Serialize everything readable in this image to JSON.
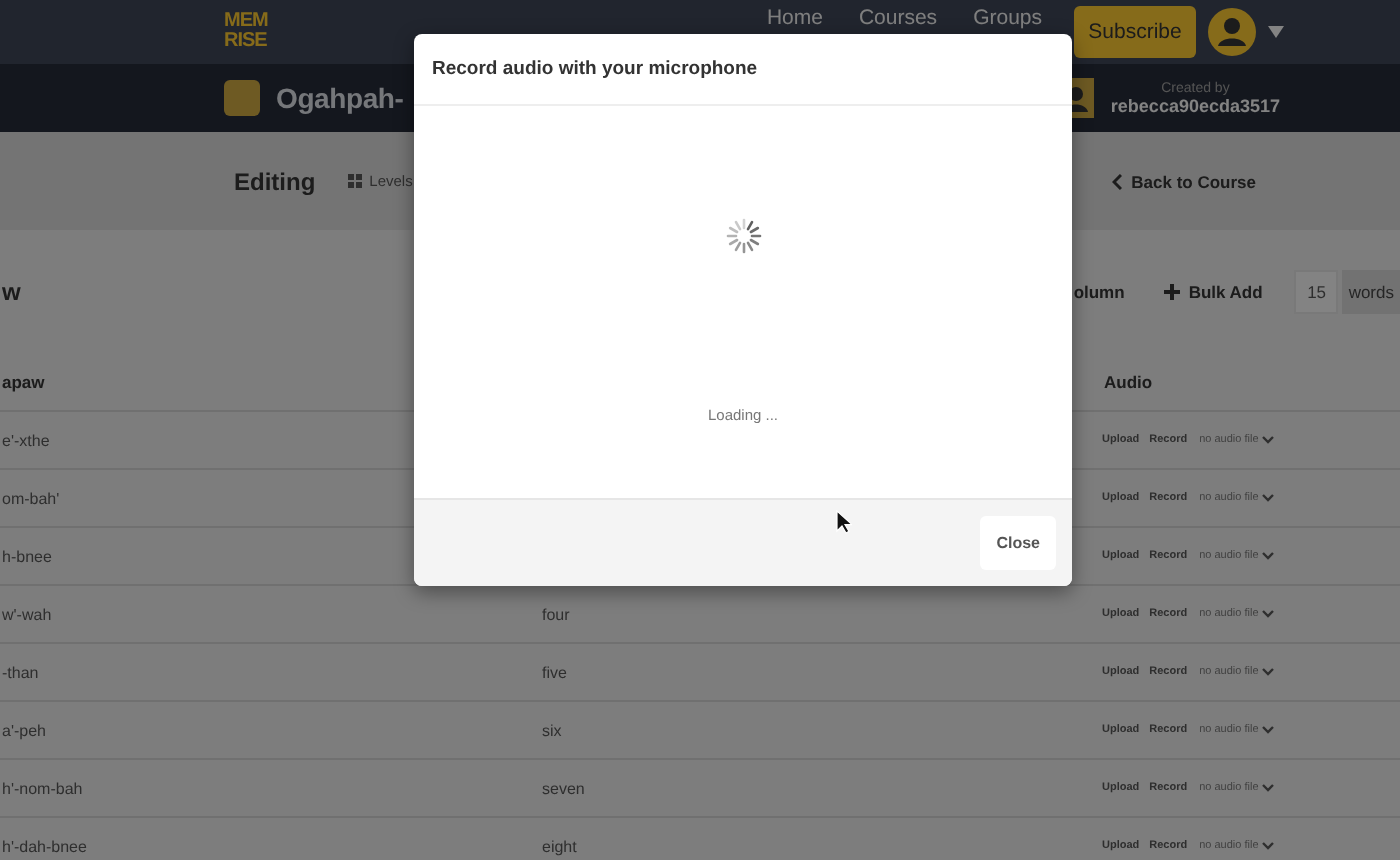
{
  "nav": {
    "logo": [
      "MEM",
      "RISE"
    ],
    "links": [
      "Home",
      "Courses",
      "Groups"
    ],
    "subscribe": "Subscribe"
  },
  "course_bar": {
    "title": "Ogahpah-",
    "created_label": "Created by",
    "creator": "rebecca90ecda3517"
  },
  "sub_nav": {
    "title": "Editing",
    "levels": "Levels",
    "back": "Back to Course"
  },
  "level": {
    "title": "w",
    "column_button": "olumn",
    "bulk_add": "Bulk Add",
    "count": "15",
    "count_unit": "words"
  },
  "table": {
    "columns": [
      "apaw",
      "Audio"
    ],
    "rows": [
      {
        "column_1": "e'-xthe",
        "audio": {
          "upload": "Upload",
          "record": "Record",
          "status": "no audio file"
        }
      },
      {
        "column_1": "om-bah'",
        "audio": {
          "upload": "Upload",
          "record": "Record",
          "status": "no audio file"
        }
      },
      {
        "column_1": "h-bnee",
        "audio": {
          "upload": "Upload",
          "record": "Record",
          "status": "no audio file"
        }
      },
      {
        "column_1": "w'-wah",
        "column_2": "four",
        "audio": {
          "upload": "Upload",
          "record": "Record",
          "status": "no audio file"
        }
      },
      {
        "column_1": "-than",
        "column_2": "five",
        "audio": {
          "upload": "Upload",
          "record": "Record",
          "status": "no audio file"
        }
      },
      {
        "column_1": "a'-peh",
        "column_2": "six",
        "audio": {
          "upload": "Upload",
          "record": "Record",
          "status": "no audio file"
        }
      },
      {
        "column_1": "h'-nom-bah",
        "column_2": "seven",
        "audio": {
          "upload": "Upload",
          "record": "Record",
          "status": "no audio file"
        }
      },
      {
        "column_1": "h'-dah-bnee",
        "column_2": "eight",
        "audio": {
          "upload": "Upload",
          "record": "Record",
          "status": "no audio file"
        }
      }
    ]
  },
  "modal": {
    "title": "Record audio with your microphone",
    "message": "Loading ...",
    "close": "Close"
  }
}
